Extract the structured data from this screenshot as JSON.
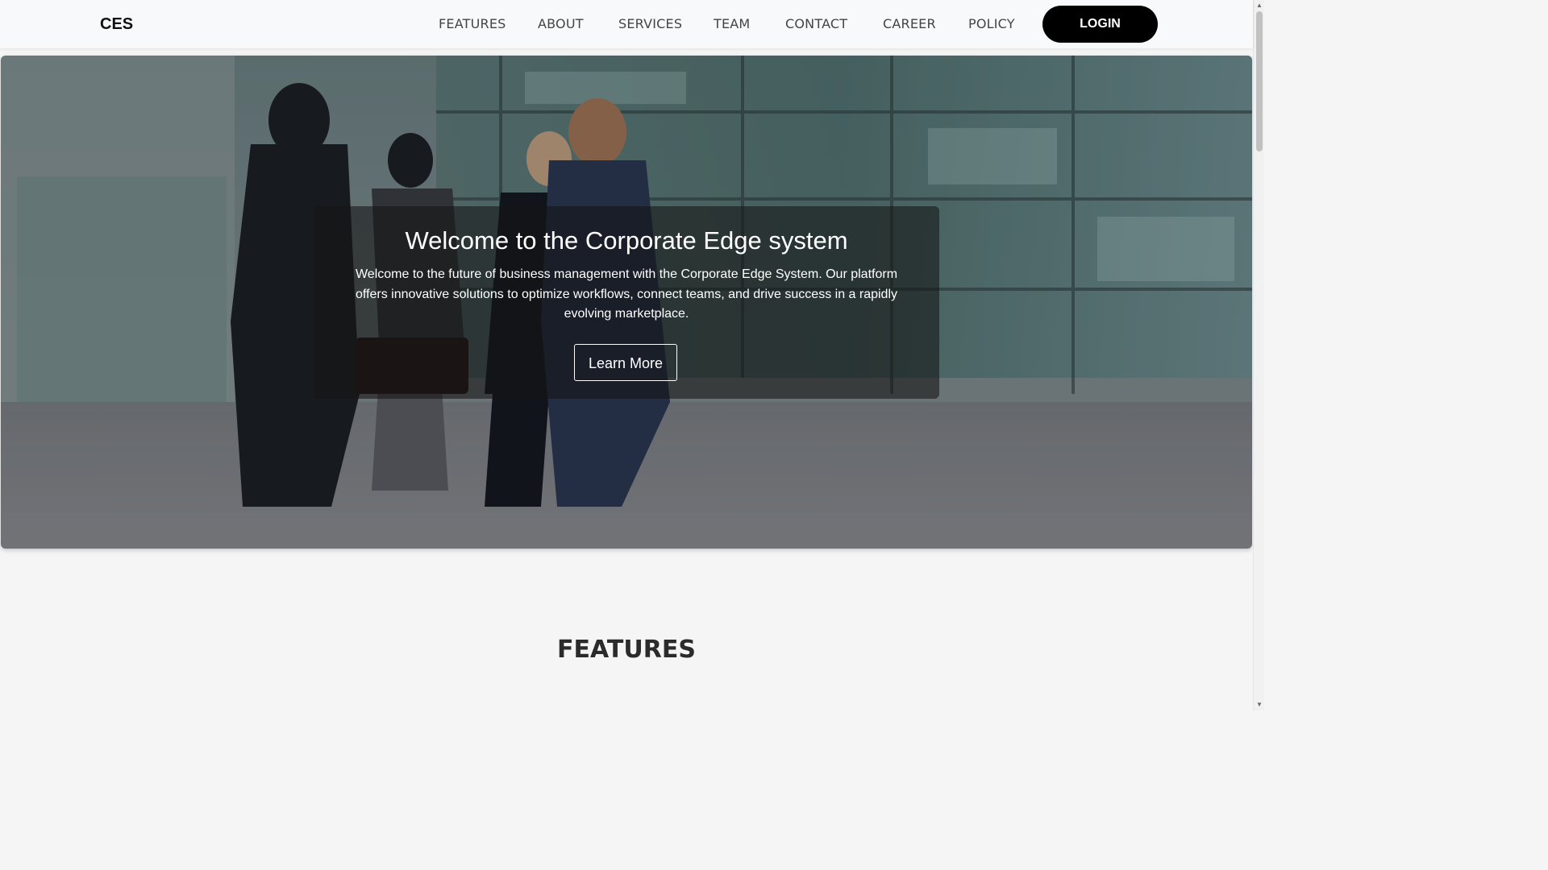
{
  "navbar": {
    "brand": "CES",
    "links": [
      "FEATURES",
      "ABOUT",
      "SERVICES",
      "TEAM",
      "CONTACT",
      "CAREER",
      "POLICY"
    ],
    "login_label": "LOGIN"
  },
  "hero": {
    "title": "Welcome to the Corporate Edge system",
    "text": "Welcome to the future of business management with the Corporate Edge System. Our platform offers innovative solutions to optimize workflows, connect teams, and drive success in a rapidly evolving marketplace.",
    "button_label": "Learn More",
    "image_icon": "business-people-photo"
  },
  "features": {
    "heading": "FEATURES"
  },
  "scrollbar": {
    "up_icon": "scroll-up-arrow-icon",
    "down_icon": "scroll-down-arrow-icon"
  }
}
